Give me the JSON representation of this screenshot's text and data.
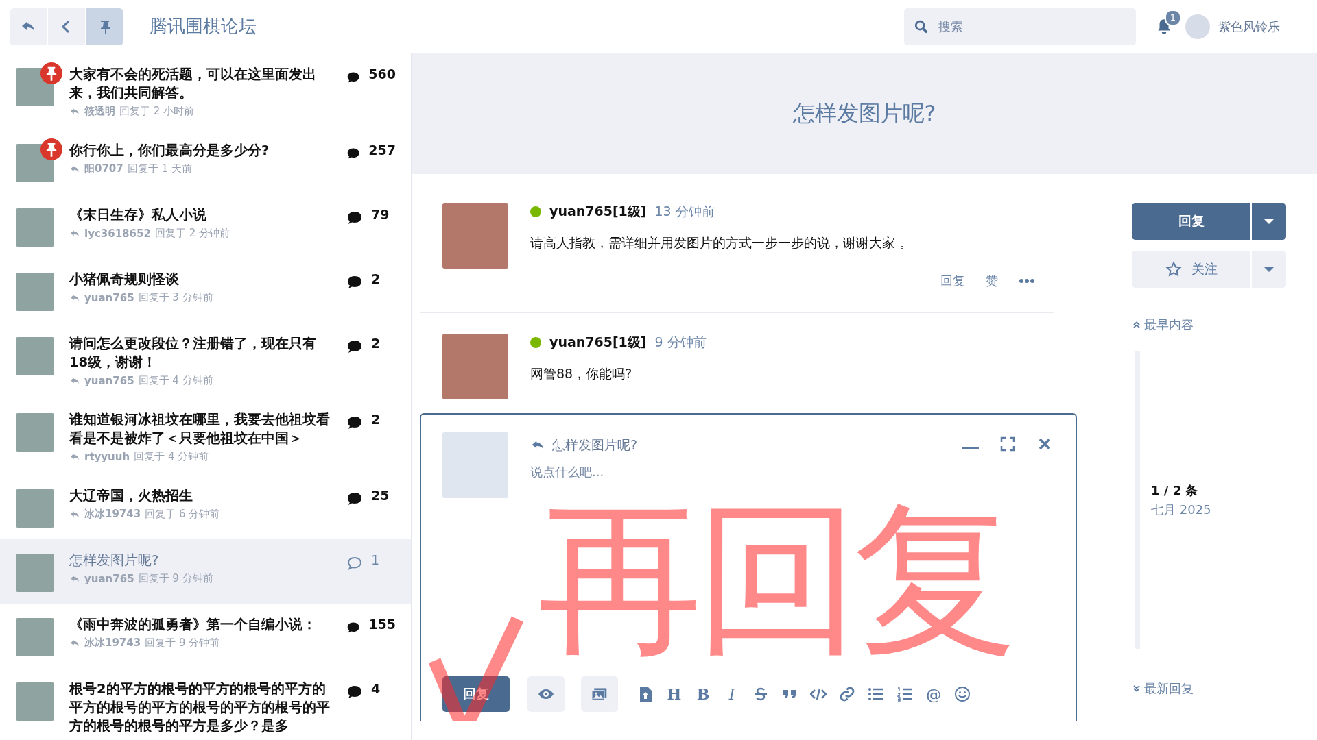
{
  "header": {
    "buttons": [
      {
        "kind": "reply",
        "selected": false
      },
      {
        "kind": "back",
        "selected": false
      },
      {
        "kind": "pin",
        "selected": true
      }
    ],
    "site_title": "腾讯围棋论坛",
    "search": {
      "placeholder": "搜索"
    },
    "notifications": "1",
    "username": "紫色风铃乐"
  },
  "topics": [
    {
      "title": "大家有不会的死活题，可以在这里面发出来，我们共同解答。",
      "user": "筱透明",
      "when": "回复于 2 小时前",
      "count": "560",
      "pinned": true,
      "selected": false,
      "read": false
    },
    {
      "title": "你行你上，你们最高分是多少分?",
      "user": "阳0707",
      "when": "回复于 1 天前",
      "count": "257",
      "pinned": true,
      "selected": false,
      "read": false
    },
    {
      "title": "《末日生存》私人小说",
      "user": "lyc3618652",
      "when": "回复于 2 分钟前",
      "count": "79",
      "pinned": false,
      "selected": false,
      "read": false
    },
    {
      "title": "小猪佩奇规则怪谈",
      "user": "yuan765",
      "when": "回复于 3 分钟前",
      "count": "2",
      "pinned": false,
      "selected": false,
      "read": false
    },
    {
      "title": "请问怎么更改段位？注册错了，现在只有18级，谢谢！",
      "user": "yuan765",
      "when": "回复于 4 分钟前",
      "count": "2",
      "pinned": false,
      "selected": false,
      "read": false
    },
    {
      "title": "谁知道银河冰祖坟在哪里，我要去他祖坟看看是不是被炸了＜只要他祖坟在中国＞",
      "user": "rtyyuuh",
      "when": "回复于 4 分钟前",
      "count": "2",
      "pinned": false,
      "selected": false,
      "read": false
    },
    {
      "title": "大辽帝国，火热招生",
      "user": "冰冰19743",
      "when": "回复于 6 分钟前",
      "count": "25",
      "pinned": false,
      "selected": false,
      "read": false
    },
    {
      "title": "怎样发图片呢?",
      "user": "yuan765",
      "when": "回复于 9 分钟前",
      "count": "1",
      "pinned": false,
      "selected": true,
      "read": true
    },
    {
      "title": "《雨中奔波的孤勇者》第一个自编小说：",
      "user": "冰冰19743",
      "when": "回复于 9 分钟前",
      "count": "155",
      "pinned": false,
      "selected": false,
      "read": false
    },
    {
      "title": "根号2的平方的根号的平方的根号的平方的平方的根号的平方的根号的平方的根号的平方的根号的根号的平方是多少？是多",
      "count": "4",
      "pinned": false,
      "selected": false,
      "read": false
    }
  ],
  "discussion_title": "怎样发图片呢?",
  "posts": [
    {
      "author": "yuan765[1级]",
      "online": true,
      "time": "13 分钟前",
      "body": "请高人指教，需详细并用发图片的方式一步一步的说，谢谢大家 。",
      "actions": [
        "回复",
        "赞"
      ],
      "more": true
    },
    {
      "author": "yuan765[1级]",
      "online": true,
      "time": "9 分钟前",
      "body": "网管88，你能吗?"
    }
  ],
  "composer": {
    "reply_to": "怎样发图片呢?",
    "placeholder": "说点什么吧...",
    "submit": "回复",
    "toolbar": [
      {
        "kind": "preview"
      },
      {
        "kind": "image"
      },
      {
        "kind": "upload"
      },
      {
        "kind": "char",
        "text": "H"
      },
      {
        "kind": "char",
        "text": "B"
      },
      {
        "kind": "char",
        "text": "I"
      },
      {
        "kind": "strike"
      },
      {
        "kind": "quote"
      },
      {
        "kind": "code"
      },
      {
        "kind": "link"
      },
      {
        "kind": "list"
      },
      {
        "kind": "olist"
      },
      {
        "kind": "char",
        "text": "@"
      },
      {
        "kind": "emoji"
      }
    ],
    "annotation": "再回复"
  },
  "sidebar": {
    "reply": "回复",
    "follow": "关注",
    "first": "最早内容",
    "position": "1 / 2 条",
    "date": "七月 2025",
    "last": "最新回复"
  }
}
